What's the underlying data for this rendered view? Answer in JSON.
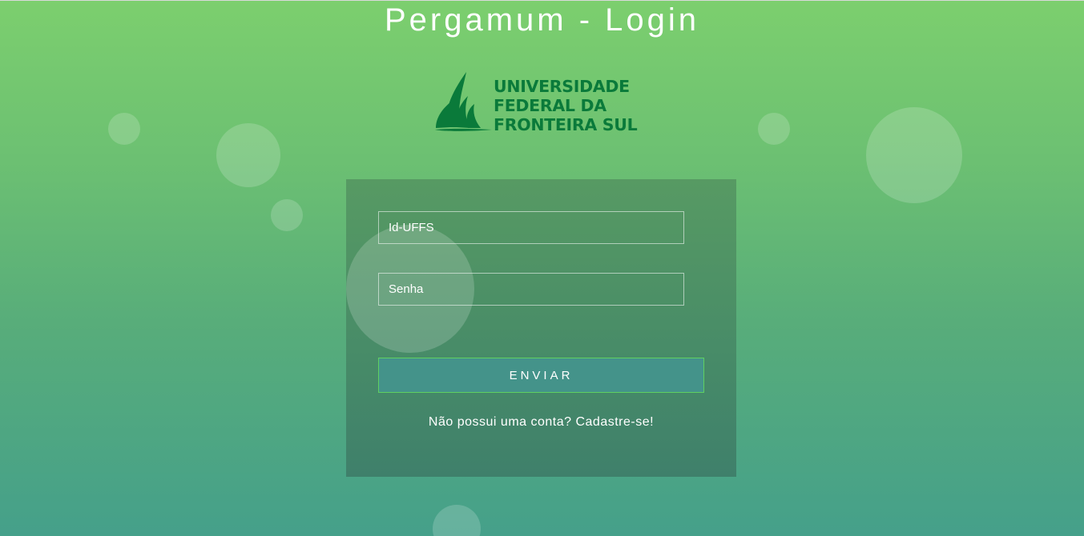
{
  "page": {
    "title": "Pergamum - Login"
  },
  "logo": {
    "line1": "UNIVERSIDADE",
    "line2": "FEDERAL DA",
    "line3": "FRONTEIRA SUL",
    "brand_color": "#0a7a3a"
  },
  "form": {
    "username_placeholder": "Id-UFFS",
    "password_placeholder": "Senha",
    "submit_label": "ENVIAR",
    "signup_link": "Não possui uma conta? Cadastre-se!"
  },
  "colors": {
    "background_top": "#7ccf6e",
    "background_bottom": "#45a08a",
    "panel": "#4f9165",
    "button": "#44938a",
    "button_border": "#5fd061"
  }
}
